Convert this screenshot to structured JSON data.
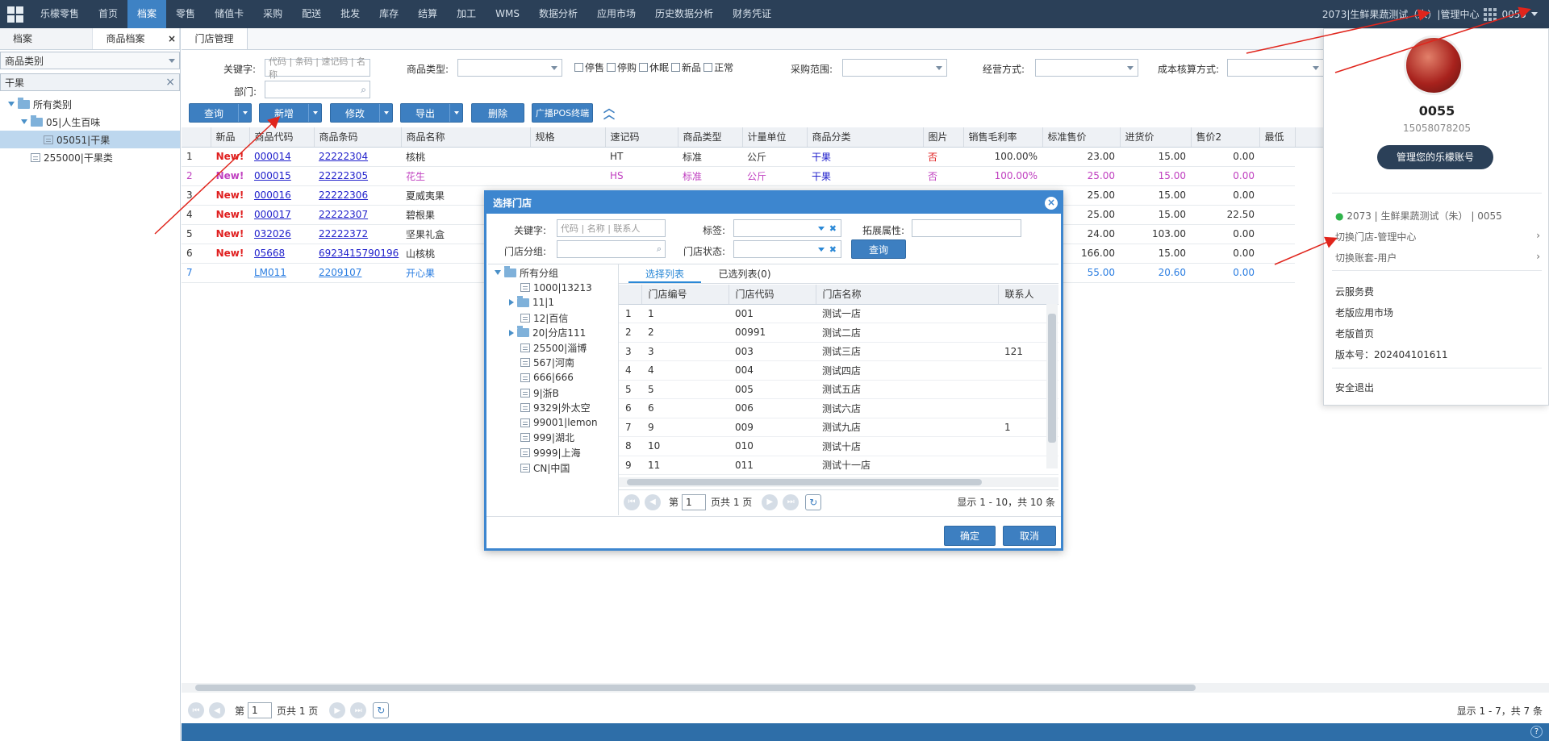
{
  "nav": {
    "brand": "乐檬零售",
    "items": [
      "首页",
      "档案",
      "零售",
      "储值卡",
      "采购",
      "配送",
      "批发",
      "库存",
      "结算",
      "加工",
      "WMS",
      "数据分析",
      "应用市场",
      "历史数据分析",
      "财务凭证"
    ],
    "active_index": 1,
    "right_store": "2073|生鲜果蔬测试（朱）|管理中心",
    "right_user": "0055"
  },
  "left": {
    "tabs": [
      "档案",
      "商品档案"
    ],
    "category_select": "商品类别",
    "filter_value": "干果",
    "tree": [
      {
        "label": "所有类别",
        "level": 0
      },
      {
        "label": "05|人生百味",
        "level": 1
      },
      {
        "label": "05051|干果",
        "level": 2,
        "selected": true
      },
      {
        "label": "255000|干果类",
        "level": 1
      }
    ]
  },
  "main": {
    "tab": "门店管理"
  },
  "filters": {
    "keyword_label": "关键字:",
    "keyword_placeholder": "代码 | 条码 | 速记码 | 名称",
    "type_label": "商品类型:",
    "checks": [
      "停售",
      "停购",
      "休眠",
      "新品",
      "正常"
    ],
    "purchase_label": "采购范围:",
    "mode_label": "经营方式:",
    "cost_label": "成本核算方式:",
    "dept_label": "部门:"
  },
  "toolbar": {
    "query": "查询",
    "add": "新增",
    "edit": "修改",
    "export": "导出",
    "delete": "删除",
    "broadcast": "广播POS终端"
  },
  "grid": {
    "headers": [
      "新品",
      "商品代码",
      "商品条码",
      "商品名称",
      "规格",
      "速记码",
      "商品类型",
      "计量单位",
      "商品分类",
      "图片",
      "销售毛利率",
      "标准售价",
      "进货价",
      "售价2",
      "最低"
    ],
    "rows": [
      {
        "n": "1",
        "new": "New!",
        "code": "000014",
        "barcode": "22222304",
        "name": "核桃",
        "spec": "",
        "short": "HT",
        "type": "标准",
        "unit": "公斤",
        "cat": "干果",
        "img": "否",
        "margin": "100.00%",
        "price": "23.00",
        "cost": "15.00",
        "p2": "0.00",
        "style": ""
      },
      {
        "n": "2",
        "new": "New!",
        "code": "000015",
        "barcode": "22222305",
        "name": "花生",
        "spec": "",
        "short": "HS",
        "type": "标准",
        "unit": "公斤",
        "cat": "干果",
        "img": "否",
        "margin": "100.00%",
        "price": "25.00",
        "cost": "15.00",
        "p2": "0.00",
        "style": "pink"
      },
      {
        "n": "3",
        "new": "New!",
        "code": "000016",
        "barcode": "22222306",
        "name": "夏威夷果",
        "spec": "",
        "short": "",
        "type": "",
        "unit": "",
        "cat": "",
        "img": "",
        "margin": "",
        "price": "25.00",
        "cost": "15.00",
        "p2": "0.00",
        "style": ""
      },
      {
        "n": "4",
        "new": "New!",
        "code": "000017",
        "barcode": "22222307",
        "name": "碧根果",
        "spec": "",
        "short": "",
        "type": "",
        "unit": "",
        "cat": "",
        "img": "",
        "margin": "",
        "price": "25.00",
        "cost": "15.00",
        "p2": "22.50",
        "style": ""
      },
      {
        "n": "5",
        "new": "New!",
        "code": "032026",
        "barcode": "22222372",
        "name": "坚果礼盒",
        "spec": "",
        "short": "",
        "type": "",
        "unit": "",
        "cat": "",
        "img": "",
        "margin": "",
        "price": "24.00",
        "cost": "103.00",
        "p2": "0.00",
        "style": ""
      },
      {
        "n": "6",
        "new": "New!",
        "code": "05668",
        "barcode": "6923415790196",
        "name": "山核桃",
        "spec": "",
        "short": "",
        "type": "",
        "unit": "",
        "cat": "",
        "img": "",
        "margin": "",
        "price": "166.00",
        "cost": "15.00",
        "p2": "0.00",
        "style": ""
      },
      {
        "n": "7",
        "new": "",
        "code": "LM011",
        "barcode": "2209107",
        "name": "开心果",
        "spec": "",
        "short": "",
        "type": "",
        "unit": "",
        "cat": "",
        "img": "",
        "margin": "",
        "price": "55.00",
        "cost": "20.60",
        "p2": "0.00",
        "style": "blue"
      }
    ]
  },
  "pager": {
    "page_prefix": "第",
    "page": "1",
    "page_suffix": "页共 1 页",
    "summary": "显示 1 - 7，共 7 条"
  },
  "modal": {
    "title": "选择门店",
    "keyword_label": "关键字:",
    "keyword_placeholder": "代码 | 名称 | 联系人",
    "tag_label": "标签:",
    "ext_label": "拓展属性:",
    "group_label": "门店分组:",
    "status_label": "门店状态:",
    "query": "查询",
    "tree": [
      {
        "label": "所有分组",
        "kind": "root"
      },
      {
        "label": "1000|13213",
        "kind": "leaf"
      },
      {
        "label": "11|1",
        "kind": "folder"
      },
      {
        "label": "12|百信",
        "kind": "leaf"
      },
      {
        "label": "20|分店111",
        "kind": "folder"
      },
      {
        "label": "25500|淄博",
        "kind": "leaf"
      },
      {
        "label": "567|河南",
        "kind": "leaf"
      },
      {
        "label": "666|666",
        "kind": "leaf"
      },
      {
        "label": "9|浙B",
        "kind": "leaf"
      },
      {
        "label": "9329|外太空",
        "kind": "leaf"
      },
      {
        "label": "99001|lemon",
        "kind": "leaf"
      },
      {
        "label": "999|湖北",
        "kind": "leaf"
      },
      {
        "label": "9999|上海",
        "kind": "leaf"
      },
      {
        "label": "CN|中国",
        "kind": "leaf"
      }
    ],
    "tabs": [
      "选择列表",
      "已选列表(0)"
    ],
    "headers": [
      "门店编号",
      "门店代码",
      "门店名称",
      "联系人"
    ],
    "rows": [
      [
        "1",
        "1",
        "001",
        "测试一店",
        ""
      ],
      [
        "2",
        "2",
        "00991",
        "测试二店",
        ""
      ],
      [
        "3",
        "3",
        "003",
        "测试三店",
        "121"
      ],
      [
        "4",
        "4",
        "004",
        "测试四店",
        ""
      ],
      [
        "5",
        "5",
        "005",
        "测试五店",
        ""
      ],
      [
        "6",
        "6",
        "006",
        "测试六店",
        ""
      ],
      [
        "7",
        "9",
        "009",
        "测试九店",
        "1"
      ],
      [
        "8",
        "10",
        "010",
        "测试十店",
        ""
      ],
      [
        "9",
        "11",
        "011",
        "测试十一店",
        ""
      ]
    ],
    "page_prefix": "第",
    "page": "1",
    "page_suffix": "页共 1 页",
    "summary": "显示 1 - 10，共 10 条",
    "ok": "确定",
    "cancel": "取消"
  },
  "popup": {
    "name": "0055",
    "phone": "15058078205",
    "manage_btn": "管理您的乐檬账号",
    "store": "2073 | 生鲜果蔬测试（朱） | 0055",
    "switch_store": "切换门店-管理中心",
    "switch_account": "切换账套-用户",
    "links": [
      "云服务费",
      "老版应用市场",
      "老版首页"
    ],
    "version": "版本号：202404101611",
    "logout": "安全退出"
  }
}
